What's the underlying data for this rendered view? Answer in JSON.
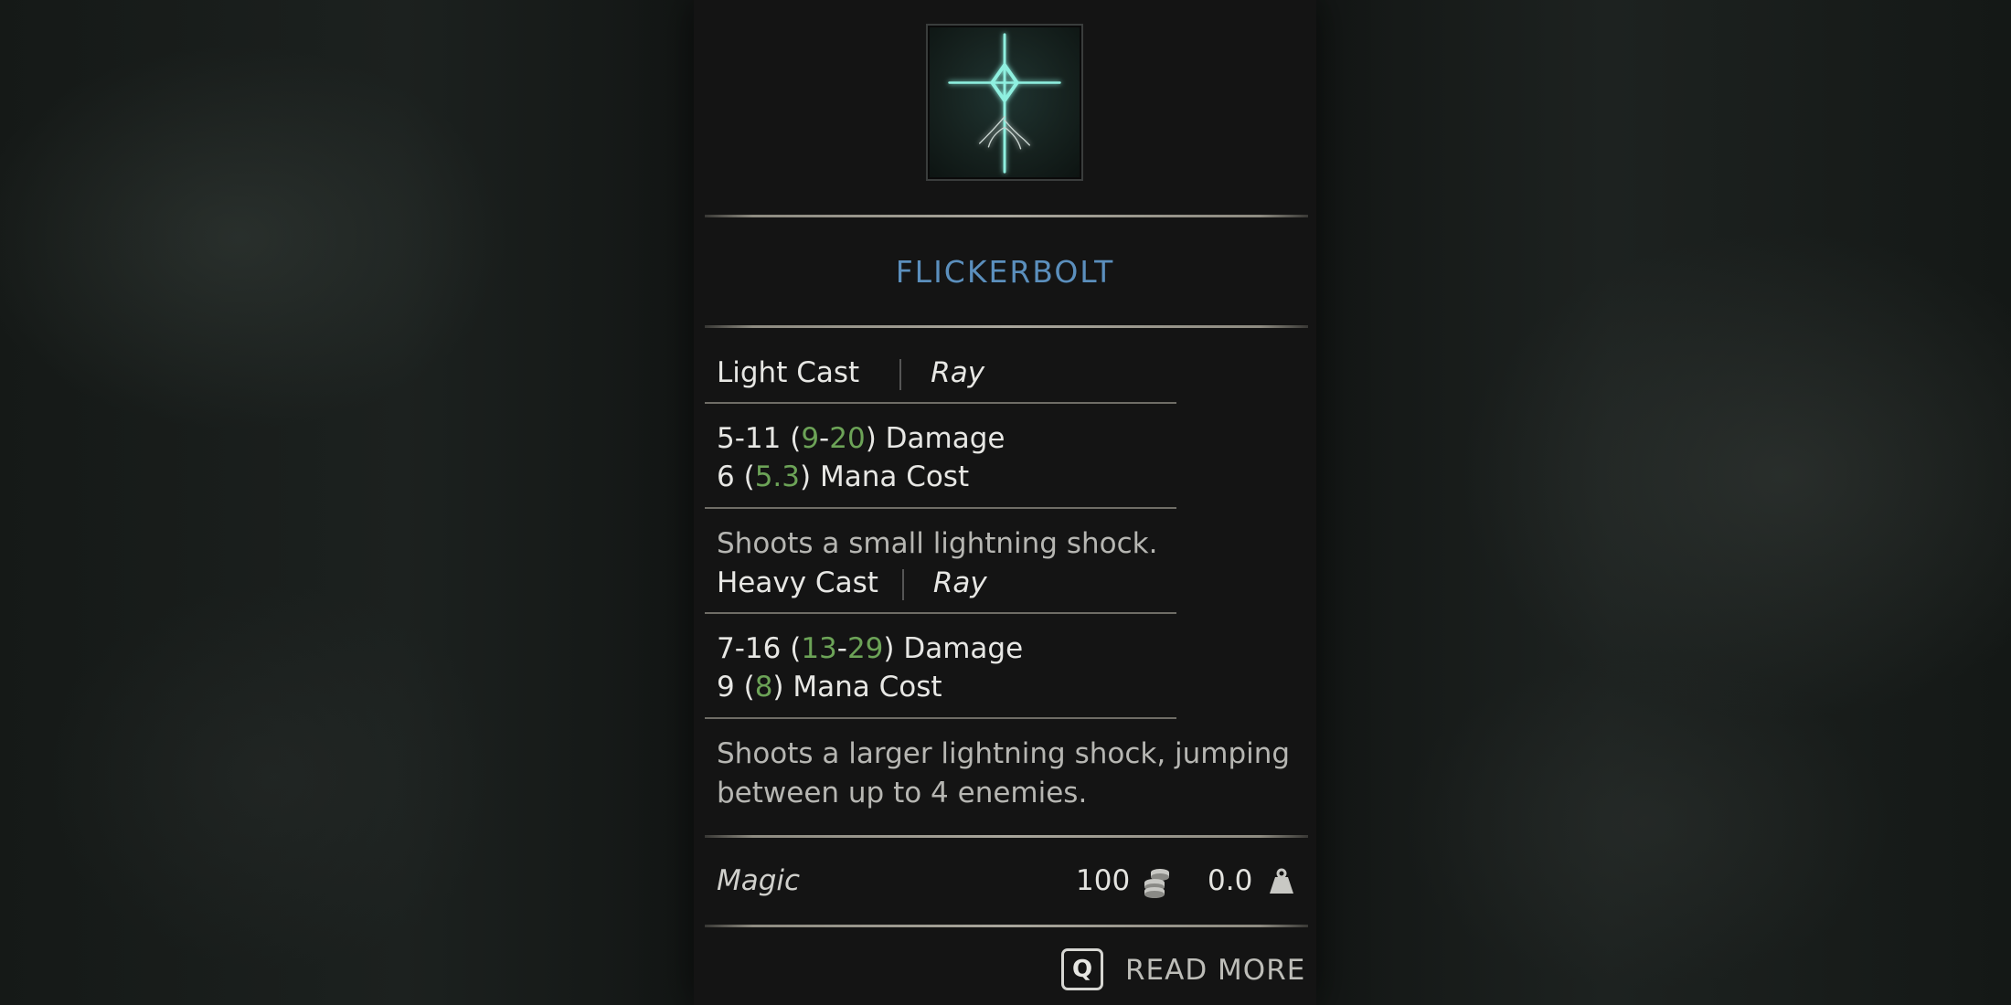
{
  "item": {
    "name": "FLICKERBOLT",
    "icon": "flickerbolt-rune-icon"
  },
  "light_cast": {
    "label": "Light Cast",
    "type": "Ray",
    "damage_base": "5-11",
    "damage_bonus_min": "9",
    "damage_bonus_max": "20",
    "damage_label": "Damage",
    "mana_base": "6",
    "mana_bonus": "5.3",
    "mana_label": "Mana Cost",
    "description": "Shoots a small lightning shock."
  },
  "heavy_cast": {
    "label": "Heavy Cast",
    "type": "Ray",
    "damage_base": "7-16",
    "damage_bonus_min": "13",
    "damage_bonus_max": "29",
    "damage_label": "Damage",
    "mana_base": "9",
    "mana_bonus": "8",
    "mana_label": "Mana Cost",
    "description_line1": "Shoots a larger lightning shock, jumping",
    "description_line2": "between up to 4 enemies."
  },
  "footer": {
    "category": "Magic",
    "value": "100",
    "value_icon": "coins-icon",
    "weight": "0.0",
    "weight_icon": "weight-icon"
  },
  "read_more": {
    "key": "Q",
    "label": "READ MORE"
  },
  "colors": {
    "title": "#5b8fbd",
    "bonus": "#6ca357",
    "panel": "#141414",
    "icon_glow": "#7fe8d8"
  }
}
